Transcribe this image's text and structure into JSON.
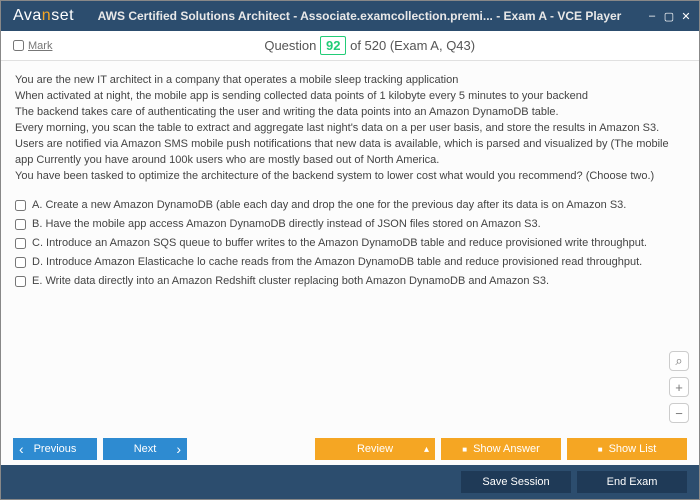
{
  "window": {
    "logo_before": "Ava",
    "logo_accent": "n",
    "logo_after": "set",
    "title": "AWS Certified Solutions Architect - Associate.examcollection.premi... - Exam A - VCE Player"
  },
  "subheader": {
    "mark": "Mark",
    "question_label_pre": "Question",
    "question_num": "92",
    "question_label_post": "of 520 (Exam A, Q43)"
  },
  "question_lines": [
    "You are the new IT architect in a company that operates a mobile sleep tracking application",
    "When activated at night, the mobile app is sending collected data points of 1 kilobyte every 5 minutes to your backend",
    "The backend takes care of authenticating the user and writing the data points into an Amazon DynamoDB table.",
    "Every morning, you scan the table to extract and aggregate last night's data on a per user basis, and store the results in Amazon S3.",
    "Users are notified via Amazon SMS mobile push notifications that new data is available, which is parsed and visualized by (The mobile app Currently you have around 100k users who are mostly based out of North America.",
    "You have been tasked to optimize the architecture of the backend system to lower cost what would you recommend? (Choose two.)"
  ],
  "options": [
    "A.  Create a new Amazon DynamoDB (able each day and drop the one for the previous day after its data is on Amazon S3.",
    "B.  Have the mobile app access Amazon DynamoDB directly instead of JSON files stored on Amazon S3.",
    "C.  Introduce an Amazon SQS queue to buffer writes to the Amazon DynamoDB table and reduce provisioned write throughput.",
    "D.  Introduce Amazon Elasticache lo cache reads from the Amazon DynamoDB table and reduce provisioned read throughput.",
    "E.  Write data directly into an Amazon Redshift cluster replacing both Amazon DynamoDB and Amazon S3."
  ],
  "buttons": {
    "previous": "Previous",
    "next": "Next",
    "review": "Review",
    "show_answer": "Show Answer",
    "show_list": "Show List",
    "save_session": "Save Session",
    "end_exam": "End Exam"
  }
}
